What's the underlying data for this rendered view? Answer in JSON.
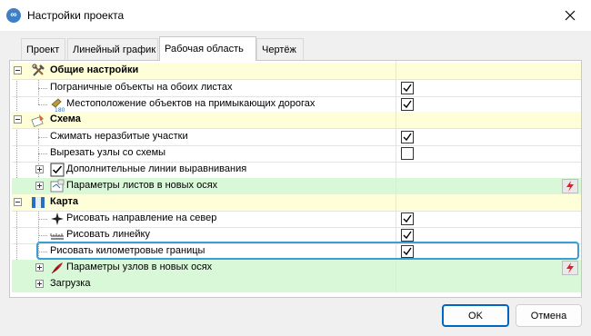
{
  "window": {
    "title": "Настройки проекта",
    "app_icon_glyph": "∞"
  },
  "tabs": [
    {
      "label": "Проект",
      "active": false
    },
    {
      "label": "Линейный график",
      "active": false
    },
    {
      "label": "Рабочая область",
      "active": true
    },
    {
      "label": "Чертёж",
      "active": false
    }
  ],
  "tree": {
    "general": {
      "label": "Общие настройки",
      "items": [
        {
          "label": "Пограничные объекты на обоих листах",
          "checked": true
        },
        {
          "label": "Местоположение объектов на примыкающих дорогах",
          "checked": true,
          "icon_text": "180"
        }
      ]
    },
    "scheme": {
      "label": "Схема",
      "items": [
        {
          "label": "Сжимать неразбитые участки",
          "checked": true
        },
        {
          "label": "Вырезать узлы со схемы",
          "checked": false
        },
        {
          "label": "Дополнительные линии выравнивания"
        },
        {
          "label": "Параметры листов в новых осях"
        }
      ]
    },
    "map": {
      "label": "Карта",
      "items": [
        {
          "label": "Рисовать направление на север",
          "checked": true
        },
        {
          "label": "Рисовать линейку",
          "checked": true
        },
        {
          "label": "Рисовать километровые границы",
          "checked": true
        },
        {
          "label": "Параметры узлов в новых осях"
        }
      ]
    },
    "load": {
      "label": "Загрузка"
    }
  },
  "buttons": {
    "ok": "OK",
    "cancel": "Отмена"
  },
  "colors": {
    "group_bg": "#fefed8",
    "link_bg": "#d8f8d8",
    "focus": "#3a9ed6",
    "accent": "#0067c0"
  }
}
